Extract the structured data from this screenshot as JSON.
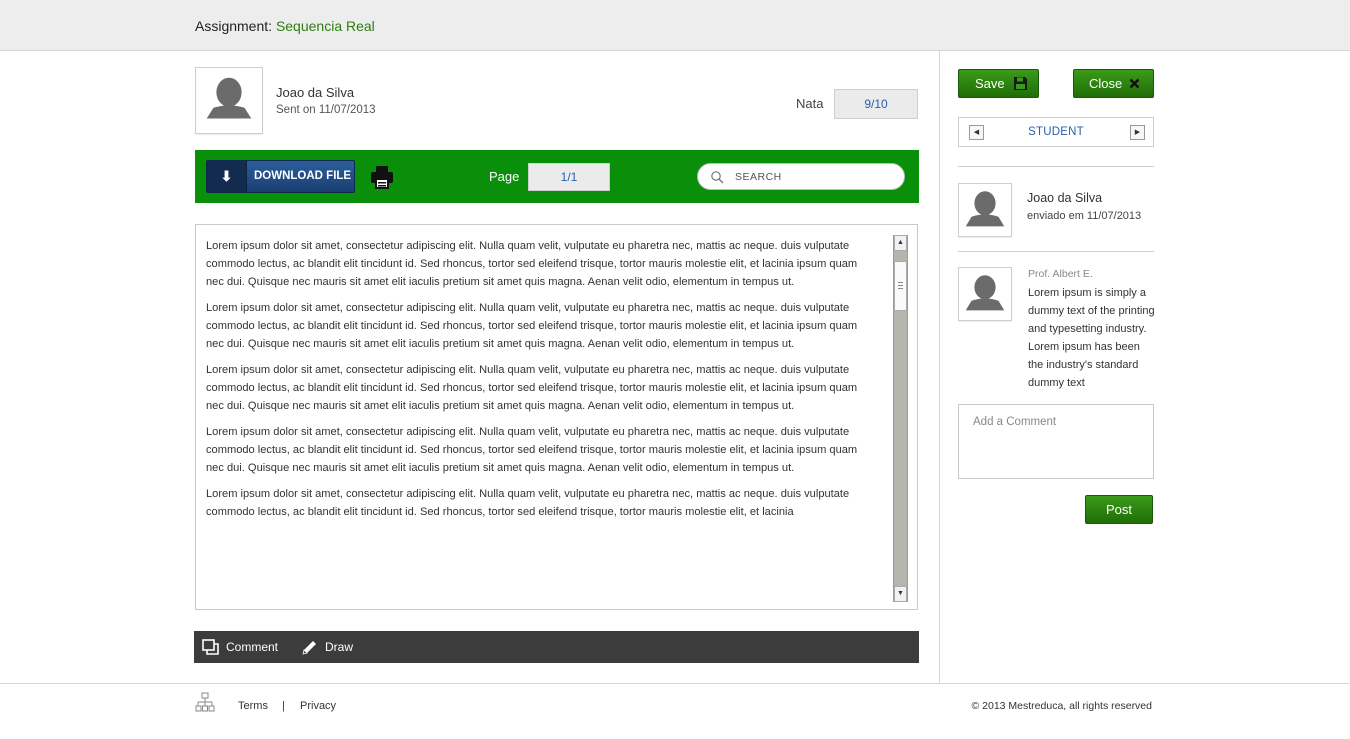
{
  "header": {
    "label": "Assignment:",
    "assignment_name": "Sequencia Real"
  },
  "submission": {
    "student_name": "Joao da Silva",
    "sent_on": "Sent on 11/07/2013",
    "grade_label": "Nata",
    "grade_value": "9/10"
  },
  "toolbar": {
    "download_label": "DOWNLOAD FILE",
    "download_icon": "download-arrow-icon",
    "print_icon": "printer-icon",
    "page_label": "Page",
    "page_value": "1/1",
    "search_placeholder": "SEARCH",
    "accent_color": "#0a8f0a"
  },
  "document": {
    "paragraphs": [
      "Lorem ipsum dolor sit amet, consectetur adipiscing elit. Nulla quam velit, vulputate eu pharetra nec, mattis ac neque. duis vulputate commodo lectus, ac blandit elit tincidunt id. Sed rhoncus, tortor sed eleifend trisque, tortor mauris molestie elit, et lacinia ipsum quam nec dui. Quisque nec mauris sit amet elit iaculis pretium sit amet quis magna. Aenan velit odio, elementum in tempus ut.",
      "Lorem ipsum dolor sit amet, consectetur adipiscing elit. Nulla quam velit, vulputate eu pharetra nec, mattis ac neque. duis vulputate commodo lectus, ac blandit elit tincidunt id. Sed rhoncus, tortor sed eleifend trisque, tortor mauris molestie elit, et lacinia ipsum quam nec dui. Quisque nec mauris sit amet elit iaculis pretium sit amet quis magna. Aenan velit odio, elementum in tempus ut.",
      "Lorem ipsum dolor sit amet, consectetur adipiscing elit. Nulla quam velit, vulputate eu pharetra nec, mattis ac neque. duis vulputate commodo lectus, ac blandit elit tincidunt id. Sed rhoncus, tortor sed eleifend trisque, tortor mauris molestie elit, et lacinia ipsum quam nec dui. Quisque nec mauris sit amet elit iaculis pretium sit amet quis magna. Aenan velit odio, elementum in tempus ut.",
      "Lorem ipsum dolor sit amet, consectetur adipiscing elit. Nulla quam velit, vulputate eu pharetra nec, mattis ac neque. duis vulputate commodo lectus, ac blandit elit tincidunt id. Sed rhoncus, tortor sed eleifend trisque, tortor mauris molestie elit, et lacinia ipsum quam nec dui. Quisque nec mauris sit amet elit iaculis pretium sit amet quis magna. Aenan velit odio, elementum in tempus ut.",
      "Lorem ipsum dolor sit amet, consectetur adipiscing elit. Nulla quam velit, vulputate eu pharetra nec, mattis ac neque. duis vulputate commodo lectus, ac blandit elit tincidunt id. Sed rhoncus, tortor sed eleifend trisque, tortor mauris molestie elit, et lacinia"
    ]
  },
  "annotation_bar": {
    "comment_label": "Comment",
    "draw_label": "Draw"
  },
  "sidebar": {
    "save_label": "Save",
    "close_label": "Close",
    "nav_label": "STUDENT",
    "student": {
      "name": "Joao da Silva",
      "sent": "enviado em 11/07/2013"
    },
    "teacher": {
      "name": "Prof. Albert E.",
      "comment": "Lorem ipsum is simply a dummy text of the printing and typesetting industry. Lorem ipsum has been the industry's standard dummy text"
    },
    "comment_placeholder": "Add a Comment",
    "post_label": "Post"
  },
  "footer": {
    "terms": "Terms",
    "separator": "|",
    "privacy": "Privacy",
    "copyright": "© 2013 Mestreduca, all rights reserved"
  }
}
